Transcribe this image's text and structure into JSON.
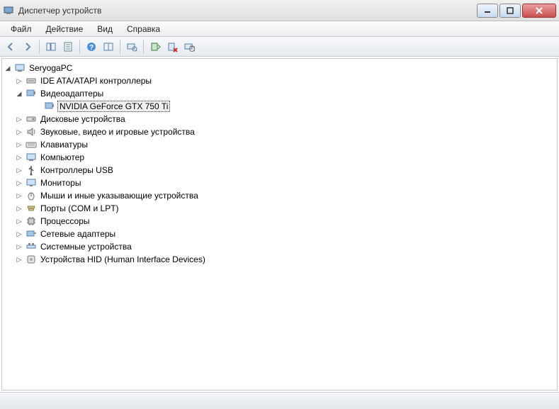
{
  "window": {
    "title": "Диспетчер устройств"
  },
  "menu": {
    "file": "Файл",
    "action": "Действие",
    "view": "Вид",
    "help": "Справка"
  },
  "tree": {
    "root": "SeryogaPC",
    "ide": "IDE ATA/ATAPI контроллеры",
    "video": "Видеоадаптеры",
    "gpu": "NVIDIA GeForce GTX 750 Ti",
    "disk": "Дисковые устройства",
    "sound": "Звуковые, видео и игровые устройства",
    "keyboard": "Клавиатуры",
    "computer": "Компьютер",
    "usb": "Контроллеры USB",
    "monitor": "Мониторы",
    "mouse": "Мыши и иные указывающие устройства",
    "ports": "Порты (COM и LPT)",
    "cpu": "Процессоры",
    "network": "Сетевые адаптеры",
    "system": "Системные устройства",
    "hid": "Устройства HID (Human Interface Devices)"
  }
}
